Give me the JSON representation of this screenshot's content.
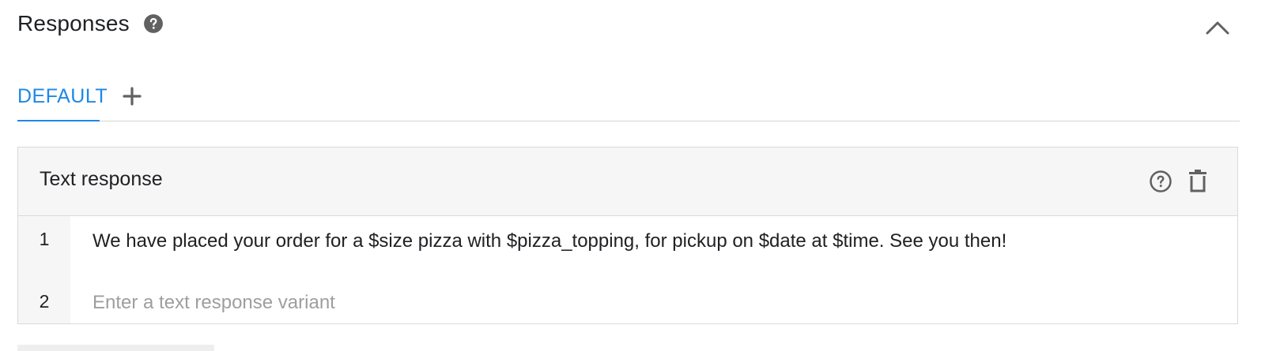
{
  "section": {
    "title": "Responses",
    "help_icon": "help-circle-filled-icon",
    "collapse_icon": "chevron-up-icon"
  },
  "tabs": {
    "items": [
      {
        "label": "DEFAULT",
        "active": true
      }
    ],
    "add_icon": "plus-icon",
    "accent_color": "#1e88e5"
  },
  "card": {
    "title": "Text response",
    "help_icon": "help-circle-outline-icon",
    "delete_icon": "trash-icon",
    "rows": [
      {
        "number": "1",
        "text": "We have placed your order for a $size pizza with $pizza_topping, for pickup on $date at $time. See you then!"
      },
      {
        "number": "2",
        "value": "",
        "placeholder": "Enter a text response variant"
      }
    ]
  }
}
